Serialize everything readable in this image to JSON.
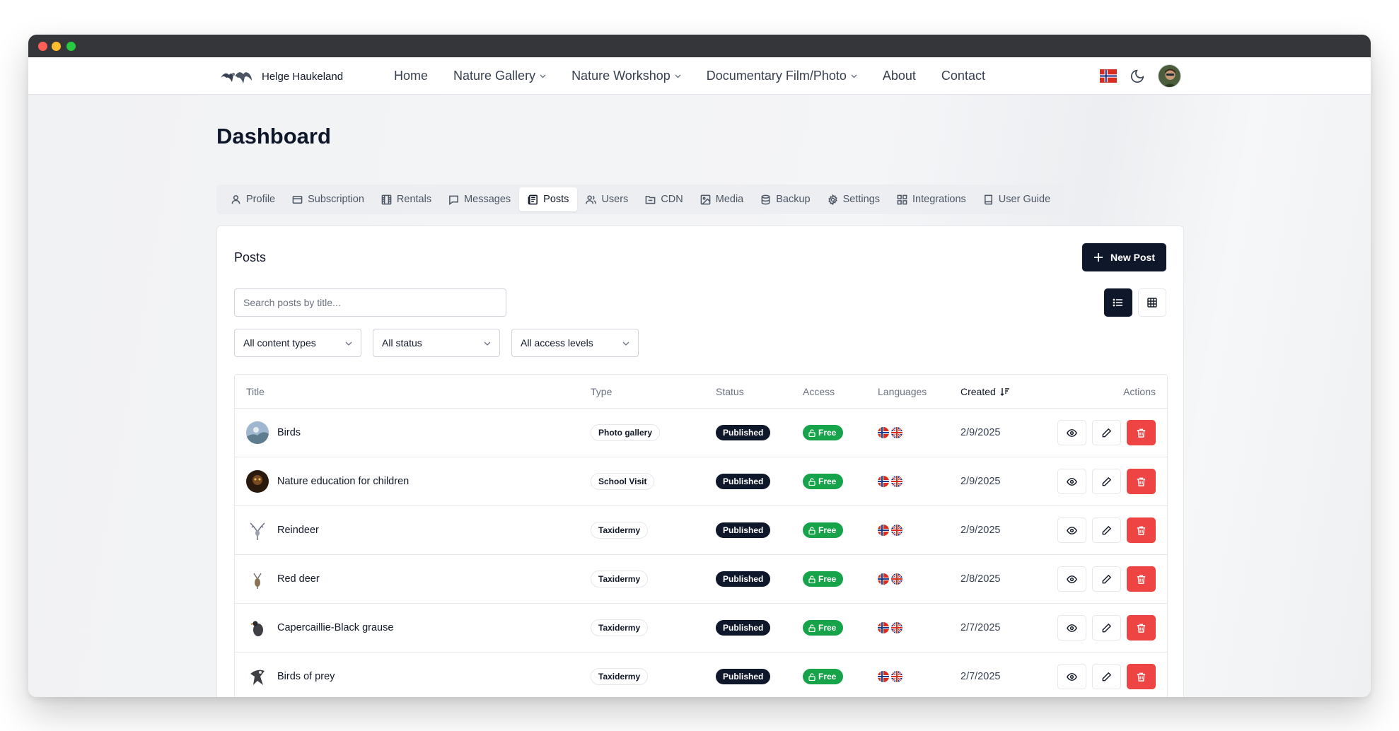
{
  "brand": {
    "name": "Helge Haukeland"
  },
  "nav": {
    "links": [
      {
        "label": "Home",
        "dropdown": false
      },
      {
        "label": "Nature Gallery",
        "dropdown": true
      },
      {
        "label": "Nature Workshop",
        "dropdown": true
      },
      {
        "label": "Documentary Film/Photo",
        "dropdown": true
      },
      {
        "label": "About",
        "dropdown": false
      },
      {
        "label": "Contact",
        "dropdown": false
      }
    ],
    "right": {
      "language_flag": "norway-flag-icon",
      "theme_toggle": "moon-icon",
      "avatar": "user-avatar"
    }
  },
  "page": {
    "title": "Dashboard"
  },
  "tabs": [
    {
      "label": "Profile",
      "icon": "user-icon",
      "active": false
    },
    {
      "label": "Subscription",
      "icon": "card-icon",
      "active": false
    },
    {
      "label": "Rentals",
      "icon": "film-icon",
      "active": false
    },
    {
      "label": "Messages",
      "icon": "message-icon",
      "active": false
    },
    {
      "label": "Posts",
      "icon": "newspaper-icon",
      "active": true
    },
    {
      "label": "Users",
      "icon": "users-icon",
      "active": false
    },
    {
      "label": "CDN",
      "icon": "folder-icon",
      "active": false
    },
    {
      "label": "Media",
      "icon": "image-icon",
      "active": false
    },
    {
      "label": "Backup",
      "icon": "database-icon",
      "active": false
    },
    {
      "label": "Settings",
      "icon": "gear-icon",
      "active": false
    },
    {
      "label": "Integrations",
      "icon": "grid-icon",
      "active": false
    },
    {
      "label": "User Guide",
      "icon": "book-icon",
      "active": false
    }
  ],
  "posts": {
    "title": "Posts",
    "new_button": "New Post",
    "search_placeholder": "Search posts by title...",
    "view_mode": "list",
    "filters": [
      "All content types",
      "All status",
      "All access levels"
    ],
    "columns": {
      "title": "Title",
      "type": "Type",
      "status": "Status",
      "access": "Access",
      "languages": "Languages",
      "created": "Created",
      "actions": "Actions"
    },
    "rows": [
      {
        "title": "Birds",
        "type": "Photo gallery",
        "status": "Published",
        "access": "Free",
        "created": "2/9/2025"
      },
      {
        "title": "Nature education for children",
        "type": "School Visit",
        "status": "Published",
        "access": "Free",
        "created": "2/9/2025"
      },
      {
        "title": "Reindeer",
        "type": "Taxidermy",
        "status": "Published",
        "access": "Free",
        "created": "2/9/2025"
      },
      {
        "title": "Red deer",
        "type": "Taxidermy",
        "status": "Published",
        "access": "Free",
        "created": "2/8/2025"
      },
      {
        "title": "Capercaillie-Black grause",
        "type": "Taxidermy",
        "status": "Published",
        "access": "Free",
        "created": "2/7/2025"
      },
      {
        "title": "Birds of prey",
        "type": "Taxidermy",
        "status": "Published",
        "access": "Free",
        "created": "2/7/2025"
      }
    ]
  },
  "colors": {
    "primary": "#0f172a",
    "success": "#16a34a",
    "danger": "#ef4444"
  }
}
